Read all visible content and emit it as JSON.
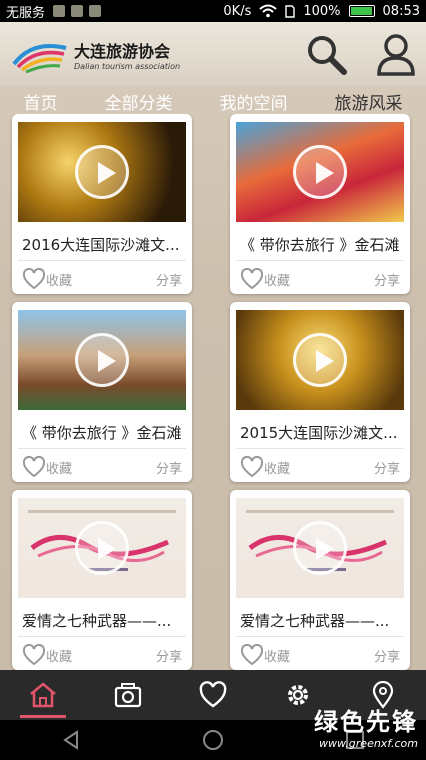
{
  "status_bar": {
    "carrier": "无服务",
    "network_speed": "0K/s",
    "battery": "100%",
    "time": "08:53"
  },
  "header": {
    "logo_title": "大连旅游协会",
    "logo_subtitle": "Dalian tourism association",
    "search_icon": "search-icon",
    "user_icon": "user-icon"
  },
  "tabs": [
    {
      "label": "首页",
      "active": false
    },
    {
      "label": "全部分类",
      "active": false
    },
    {
      "label": "我的空间",
      "active": false
    },
    {
      "label": "旅游风采",
      "active": true
    }
  ],
  "cards": [
    {
      "title": "2016大连国际沙滩文...",
      "fav_label": "收藏",
      "share_label": "分享",
      "thumb": "gold-stage"
    },
    {
      "title": "《 带你去旅行 》金石滩",
      "fav_label": "收藏",
      "share_label": "分享",
      "thumb": "carnival"
    },
    {
      "title": "《 带你去旅行 》金石滩",
      "fav_label": "收藏",
      "share_label": "分享",
      "thumb": "castle"
    },
    {
      "title": "2015大连国际沙滩文...",
      "fav_label": "收藏",
      "share_label": "分享",
      "thumb": "gold-stage"
    },
    {
      "title": "爱情之七种武器——...",
      "fav_label": "收藏",
      "share_label": "分享",
      "thumb": "love-title"
    },
    {
      "title": "爱情之七种武器——...",
      "fav_label": "收藏",
      "share_label": "分享",
      "thumb": "love-title"
    }
  ],
  "bottom_nav": [
    {
      "icon": "home-icon",
      "active": true
    },
    {
      "icon": "camera-icon",
      "active": false
    },
    {
      "icon": "heart-icon",
      "active": false
    },
    {
      "icon": "gear-icon",
      "active": false
    },
    {
      "icon": "location-pin-icon",
      "active": false
    }
  ],
  "watermark": {
    "title": "绿色先锋",
    "url": "www.greenxf.com"
  },
  "colors": {
    "accent": "#e0556a",
    "nav_bg": "#2a2a2a",
    "muted_text": "#999999"
  }
}
